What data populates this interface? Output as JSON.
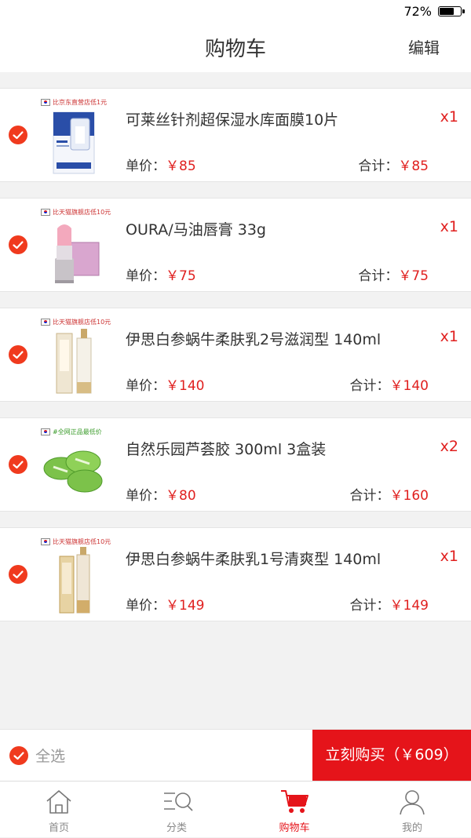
{
  "status_bar": {
    "battery_pct": "72%",
    "battery_level": 0.72
  },
  "nav": {
    "title": "购物车",
    "edit": "编辑"
  },
  "labels": {
    "unit_price": "单价：",
    "subtotal": "合计："
  },
  "items": [
    {
      "tag": "比京东直营店低1元",
      "name": "可莱丝针剂超保湿水库面膜10片",
      "qty": "x1",
      "unit_price": "￥85",
      "subtotal": "￥85",
      "image": "mask-box"
    },
    {
      "tag": "比天猫旗舰店低10元",
      "name": "OURA/马油唇膏 33g",
      "qty": "x1",
      "unit_price": "￥75",
      "subtotal": "￥75",
      "image": "lipstick"
    },
    {
      "tag": "比天猫旗舰店低10元",
      "name": "伊思白参蜗牛柔肤乳2号滋润型 140ml",
      "qty": "x1",
      "unit_price": "￥140",
      "subtotal": "￥140",
      "image": "lotion-bottle"
    },
    {
      "tag": "#全网正品最低价",
      "name": "自然乐园芦荟胶 300ml  3盒装",
      "qty": "x2",
      "unit_price": "￥80",
      "subtotal": "￥160",
      "image": "aloe-jars"
    },
    {
      "tag": "比天猫旗舰店低10元",
      "name": "伊思白参蜗牛柔肤乳1号清爽型 140ml",
      "qty": "x1",
      "unit_price": "￥149",
      "subtotal": "￥149",
      "image": "lotion-bottle-gold"
    }
  ],
  "bottom": {
    "select_all": "全选",
    "buy": "立刻购买（￥609）"
  },
  "tabs": [
    {
      "label": "首页",
      "icon": "home-icon"
    },
    {
      "label": "分类",
      "icon": "category-search-icon"
    },
    {
      "label": "购物车",
      "icon": "cart-icon",
      "active": true
    },
    {
      "label": "我的",
      "icon": "user-icon"
    }
  ],
  "colors": {
    "accent": "#e5141a",
    "check": "#f03a1e",
    "price": "#e0201f"
  }
}
